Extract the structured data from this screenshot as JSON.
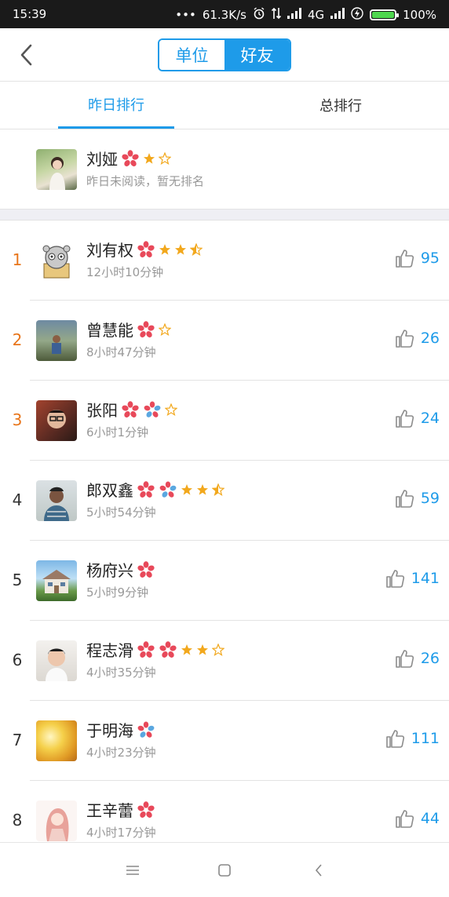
{
  "status_bar": {
    "time": "15:39",
    "dots": "•••",
    "speed": "61.3K/s",
    "network": "4G",
    "battery": "100%"
  },
  "header": {
    "seg_unit": "单位",
    "seg_friend": "好友"
  },
  "tabs": {
    "yesterday": "昨日排行",
    "total": "总排行"
  },
  "me": {
    "name": "刘娅",
    "status": "昨日未阅读，暂无排名"
  },
  "rows": [
    {
      "rank": "1",
      "name": "刘有权",
      "time": "12小时10分钟",
      "likes": "95"
    },
    {
      "rank": "2",
      "name": "曾慧能",
      "time": "8小时47分钟",
      "likes": "26"
    },
    {
      "rank": "3",
      "name": "张阳",
      "time": "6小时1分钟",
      "likes": "24"
    },
    {
      "rank": "4",
      "name": "郎双鑫",
      "time": "5小时54分钟",
      "likes": "59"
    },
    {
      "rank": "5",
      "name": "杨府兴",
      "time": "5小时9分钟",
      "likes": "141"
    },
    {
      "rank": "6",
      "name": "程志滑",
      "time": "4小时35分钟",
      "likes": "26"
    },
    {
      "rank": "7",
      "name": "于明海",
      "time": "4小时23分钟",
      "likes": "111"
    },
    {
      "rank": "8",
      "name": "王辛蕾",
      "time": "4小时17分钟",
      "likes": "44"
    }
  ],
  "colors": {
    "accent": "#1e9be9",
    "rank_top": "#e8751a",
    "star": "#f2a81d",
    "flower_red": "#e8495a",
    "flower_blue": "#5aa7e0"
  }
}
